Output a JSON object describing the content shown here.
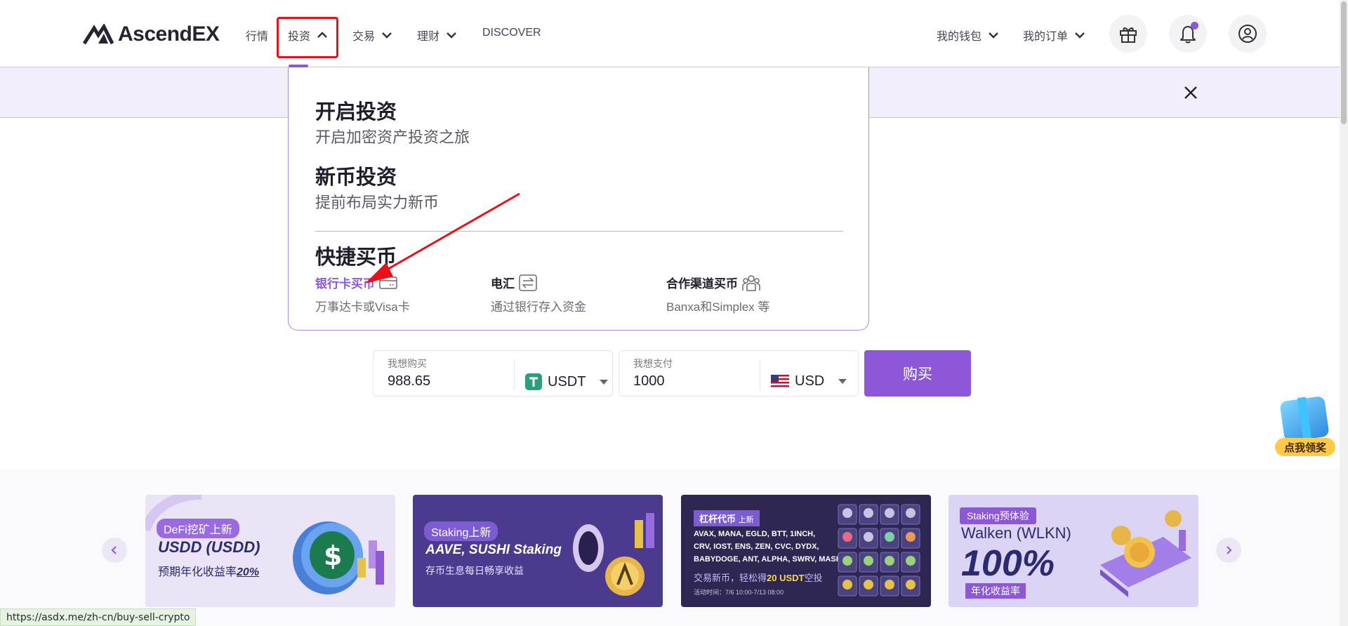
{
  "brand": {
    "name": "AscendEX"
  },
  "nav": {
    "markets": "行情",
    "invest": "投资",
    "trade": "交易",
    "finance": "理财",
    "discover": "DISCOVER",
    "wallet": "我的钱包",
    "orders": "我的订单"
  },
  "dropdown": {
    "section1": {
      "title": "开启投资",
      "subtitle": "开启加密资产投资之旅"
    },
    "section2": {
      "title": "新币投资",
      "subtitle": "提前布局实力新币"
    },
    "quick_title": "快捷买币",
    "quick_items": [
      {
        "title": "银行卡买币",
        "desc": "万事达卡或Visa卡",
        "icon": "credit-card-icon"
      },
      {
        "title": "电汇",
        "desc": "通过银行存入资金",
        "icon": "transfer-icon"
      },
      {
        "title": "合作渠道买币",
        "desc": "Banxa和Simplex 等",
        "icon": "partners-icon"
      }
    ]
  },
  "buy_form": {
    "want_buy_label": "我想购买",
    "want_buy_value": "988.65",
    "buy_currency": "USDT",
    "want_pay_label": "我想支付",
    "want_pay_value": "1000",
    "pay_currency": "USD",
    "buy_button": "购买"
  },
  "gift": {
    "label": "点我领奖"
  },
  "banners": [
    {
      "tag": "DeFi挖矿上新",
      "line1": "USDD (USDD)",
      "line2": "预期年化收益率",
      "highlight": "20%"
    },
    {
      "tag": "Staking上新",
      "line1": "AAVE, SUSHI Staking",
      "line2": "存币生息每日畅享收益"
    },
    {
      "tag": "杠杆代币",
      "tag_suffix": "上新",
      "line1": "AVAX, MANA, EGLD, BTT, 1INCH,",
      "line1b": "CRV, IOST, ENS, ZEN, CVC, DYDX,",
      "line1c": "BABYDOGE, ANT, ALPHA, SWRV, MASK",
      "line2": "交易新币，轻松得",
      "highlight": "20 USDT",
      "line2_suffix": "空投",
      "time": "活动时间：7/6 10:00-7/13 08:00"
    },
    {
      "tag": "Staking预体验",
      "line1": "Walken (WLKN)",
      "big": "100%",
      "line2": "年化收益率"
    }
  ],
  "status_url": "https://asdx.me/zh-cn/buy-sell-crypto",
  "colors": {
    "accent": "#8d58d8",
    "highlight_box": "#e8101a",
    "usdt_green": "#26a17b"
  }
}
